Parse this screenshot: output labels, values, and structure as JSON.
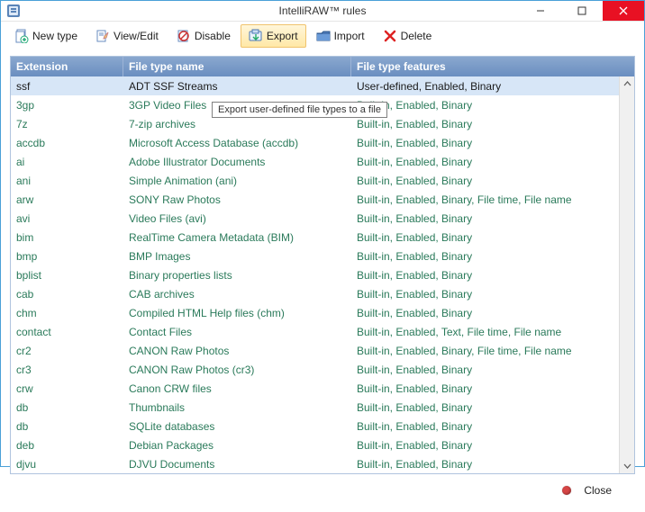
{
  "window": {
    "title": "IntelliRAW™ rules"
  },
  "toolbar": {
    "new_type": "New type",
    "view_edit": "View/Edit",
    "disable": "Disable",
    "export": "Export",
    "import": "Import",
    "delete": "Delete"
  },
  "tooltip": "Export user-defined file types to a file",
  "columns": {
    "ext": "Extension",
    "name": "File type name",
    "feat": "File type features"
  },
  "rows": [
    {
      "ext": "ssf",
      "name": "ADT SSF Streams",
      "feat": "User-defined, Enabled, Binary",
      "selected": true
    },
    {
      "ext": "3gp",
      "name": "3GP Video Files",
      "feat": "Built-in, Enabled, Binary"
    },
    {
      "ext": "7z",
      "name": "7-zip archives",
      "feat": "Built-in, Enabled, Binary"
    },
    {
      "ext": "accdb",
      "name": "Microsoft Access Database (accdb)",
      "feat": "Built-in, Enabled, Binary"
    },
    {
      "ext": "ai",
      "name": "Adobe Illustrator Documents",
      "feat": "Built-in, Enabled, Binary"
    },
    {
      "ext": "ani",
      "name": "Simple Animation (ani)",
      "feat": "Built-in, Enabled, Binary"
    },
    {
      "ext": "arw",
      "name": "SONY Raw Photos",
      "feat": "Built-in, Enabled, Binary, File time, File name"
    },
    {
      "ext": "avi",
      "name": "Video Files (avi)",
      "feat": "Built-in, Enabled, Binary"
    },
    {
      "ext": "bim",
      "name": "RealTime Camera Metadata (BIM)",
      "feat": "Built-in, Enabled, Binary"
    },
    {
      "ext": "bmp",
      "name": "BMP Images",
      "feat": "Built-in, Enabled, Binary"
    },
    {
      "ext": "bplist",
      "name": "Binary properties lists",
      "feat": "Built-in, Enabled, Binary"
    },
    {
      "ext": "cab",
      "name": "CAB archives",
      "feat": "Built-in, Enabled, Binary"
    },
    {
      "ext": "chm",
      "name": "Compiled HTML Help files (chm)",
      "feat": "Built-in, Enabled, Binary"
    },
    {
      "ext": "contact",
      "name": "Contact Files",
      "feat": "Built-in, Enabled, Text, File time, File name"
    },
    {
      "ext": "cr2",
      "name": "CANON Raw Photos",
      "feat": "Built-in, Enabled, Binary, File time, File name"
    },
    {
      "ext": "cr3",
      "name": "CANON Raw Photos (cr3)",
      "feat": "Built-in, Enabled, Binary"
    },
    {
      "ext": "crw",
      "name": "Canon CRW files",
      "feat": "Built-in, Enabled, Binary"
    },
    {
      "ext": "db",
      "name": "Thumbnails",
      "feat": "Built-in, Enabled, Binary"
    },
    {
      "ext": "db",
      "name": "SQLite databases",
      "feat": "Built-in, Enabled, Binary"
    },
    {
      "ext": "deb",
      "name": "Debian Packages",
      "feat": "Built-in, Enabled, Binary"
    },
    {
      "ext": "djvu",
      "name": "DJVU Documents",
      "feat": "Built-in, Enabled, Binary"
    }
  ],
  "footer": {
    "close": "Close"
  }
}
